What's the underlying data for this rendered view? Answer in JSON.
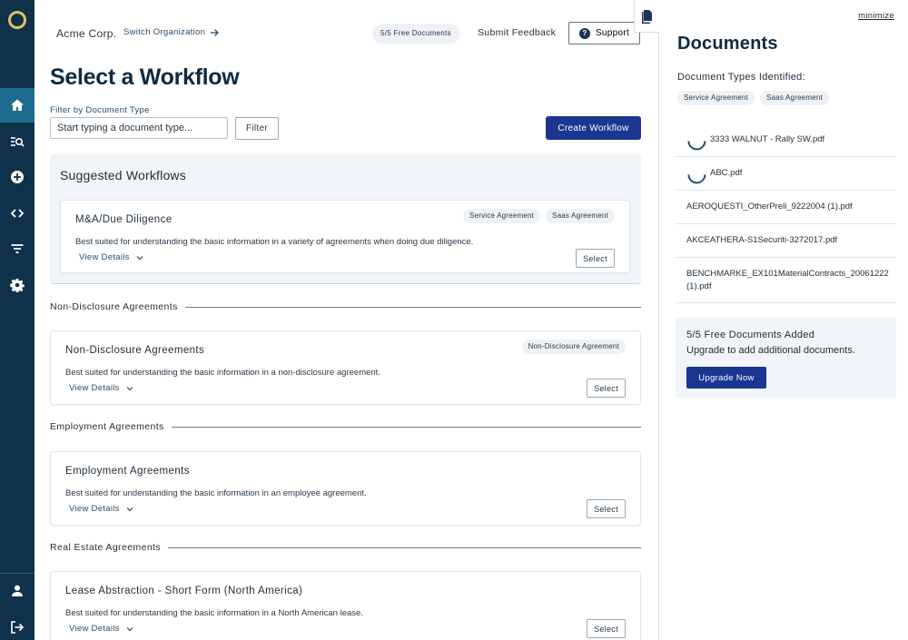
{
  "topbar": {
    "org_name": "Acme Corp.",
    "switch_label": "Switch Organization",
    "free_docs_badge": "5/5 Free Documents",
    "feedback_label": "Submit Feedback",
    "support_label": "Support"
  },
  "page": {
    "title": "Select a Workflow",
    "filter_label": "Filter by Document Type",
    "filter_placeholder": "Start typing a document type...",
    "filter_button": "Filter",
    "create_button": "Create Workflow"
  },
  "suggested": {
    "title": "Suggested Workflows",
    "card": {
      "title": "M&A/Due Diligence",
      "tags": [
        "Service Agreement",
        "Saas Agreement"
      ],
      "description": "Best suited for understanding the basic information in a variety of agreements when doing due diligence.",
      "details_label": "View Details",
      "select_label": "Select"
    }
  },
  "sections": [
    {
      "heading": "Non-Disclosure Agreements",
      "card": {
        "title": "Non-Disclosure Agreements",
        "tags": [
          "Non-Disclosure Agreement"
        ],
        "description": "Best suited for understanding the basic information in a non-disclosure agreement.",
        "details_label": "View Details",
        "select_label": "Select"
      }
    },
    {
      "heading": "Employment Agreements",
      "card": {
        "title": "Employment Agreements",
        "tags": [],
        "description": "Best suited for understanding the basic information in an employee agreement.",
        "details_label": "View Details",
        "select_label": "Select"
      }
    },
    {
      "heading": "Real Estate Agreements",
      "card": {
        "title": "Lease Abstraction - Short Form (North America)",
        "tags": [],
        "description": "Best suited for understanding the basic information in a North American lease.",
        "details_label": "View Details",
        "select_label": "Select"
      }
    }
  ],
  "panel": {
    "minimize_label": "minimize",
    "title": "Documents",
    "types_label": "Document Types Identified:",
    "types": [
      "Service Agreement",
      "Saas Agreement"
    ],
    "documents": [
      {
        "name": "3333 WALNUT - Rally SW.pdf",
        "loading": true
      },
      {
        "name": "ABC.pdf",
        "loading": true
      },
      {
        "name": "AEROQUESTI_OtherPreli_9222004 (1).pdf",
        "loading": false
      },
      {
        "name": "AKCEATHERA-S1Securiti-3272017.pdf",
        "loading": false
      },
      {
        "name": "BENCHMARKE_EX101MaterialContracts_20061222 (1).pdf",
        "loading": false
      }
    ],
    "upgrade": {
      "title": "5/5 Free Documents Added",
      "subtitle": "Upgrade to add additional documents.",
      "button": "Upgrade Now"
    }
  },
  "colors": {
    "rail": "#0f3149",
    "rail_active": "#1d6b8c",
    "primary_button": "#1b3691",
    "logo_ring": "#e2bf63"
  },
  "icons": {
    "rail": [
      "home-icon",
      "search-list-icon",
      "add-circle-icon",
      "code-icon",
      "filter-icon",
      "settings-icon",
      "user-icon",
      "logout-icon"
    ]
  }
}
